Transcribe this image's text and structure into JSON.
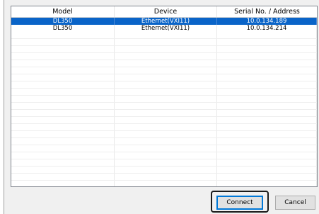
{
  "list": {
    "columns": [
      "Model",
      "Device",
      "Serial No. / Address"
    ],
    "rows": [
      {
        "model": "DL350",
        "device": "Ethernet(VXI11)",
        "address": "10.0.134.189",
        "selected": true
      },
      {
        "model": "DL350",
        "device": "Ethernet(VXI11)",
        "address": "10.0.134.214",
        "selected": false
      }
    ]
  },
  "buttons": {
    "connect": "Connect",
    "cancel": "Cancel"
  },
  "colors": {
    "selection": "#0a64c8",
    "highlight_frame": "#1a1a1a"
  }
}
